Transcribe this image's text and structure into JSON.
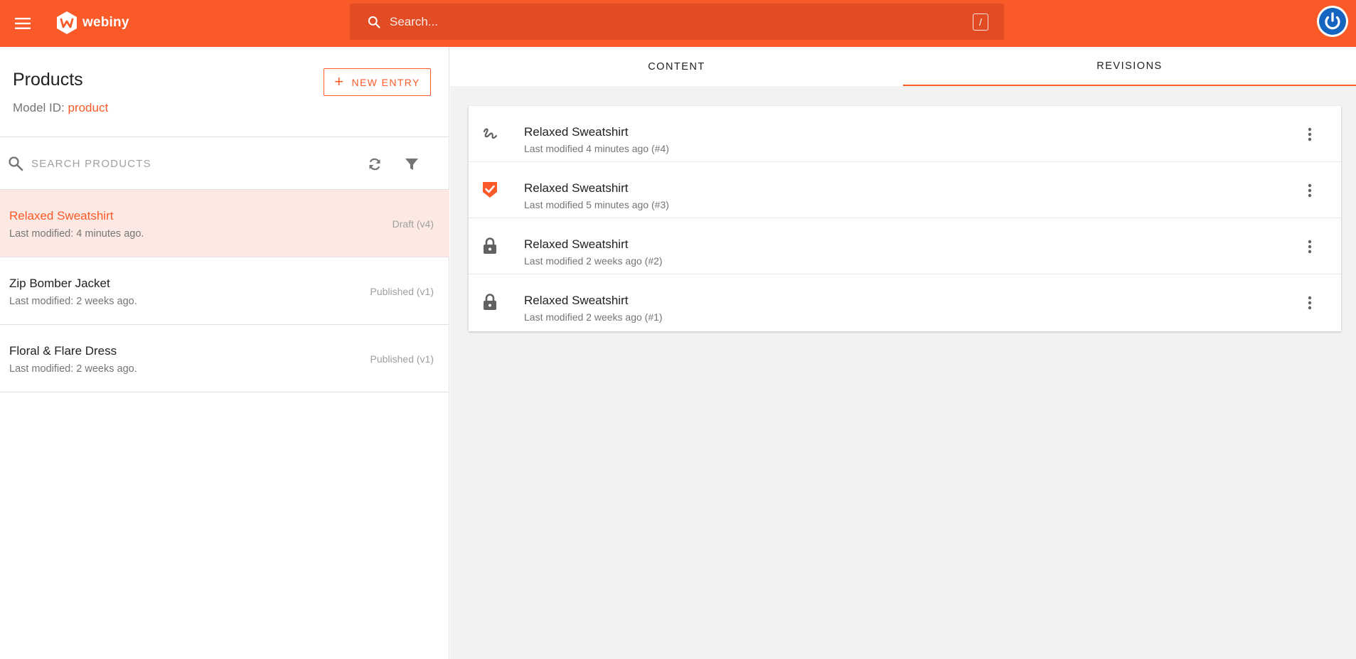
{
  "app": {
    "name": "webiny",
    "colors": {
      "brand": "#fa5a28",
      "brand_dark": "#e24c24",
      "active_row_bg": "#fde9e3",
      "avatar_blue": "#1565c0"
    }
  },
  "topbar": {
    "menu_icon": "hamburger-menu-icon",
    "search_placeholder": "Search...",
    "search_shortcut": "/",
    "avatar_icon": "power-icon"
  },
  "left": {
    "title": "Products",
    "model_id_label": "Model ID:",
    "model_id_value": "product",
    "new_entry_label": "NEW ENTRY",
    "search_placeholder": "SEARCH PRODUCTS",
    "entries": [
      {
        "title": "Relaxed Sweatshirt",
        "subtitle": "Last modified: 4 minutes ago.",
        "status": "Draft (v4)"
      },
      {
        "title": "Zip Bomber Jacket",
        "subtitle": "Last modified: 2 weeks ago.",
        "status": "Published (v1)"
      },
      {
        "title": "Floral & Flare Dress",
        "subtitle": "Last modified: 2 weeks ago.",
        "status": "Published (v1)"
      }
    ]
  },
  "right": {
    "tabs": [
      {
        "label": "CONTENT"
      },
      {
        "label": "REVISIONS"
      }
    ],
    "revisions": [
      {
        "icon": "draft-squiggle-icon",
        "title": "Relaxed Sweatshirt",
        "subtitle": "Last modified 4 minutes ago (#4)"
      },
      {
        "icon": "published-check-icon",
        "title": "Relaxed Sweatshirt",
        "subtitle": "Last modified 5 minutes ago (#3)"
      },
      {
        "icon": "lock-icon",
        "title": "Relaxed Sweatshirt",
        "subtitle": "Last modified 2 weeks ago (#2)"
      },
      {
        "icon": "lock-icon",
        "title": "Relaxed Sweatshirt",
        "subtitle": "Last modified 2 weeks ago (#1)"
      }
    ]
  }
}
